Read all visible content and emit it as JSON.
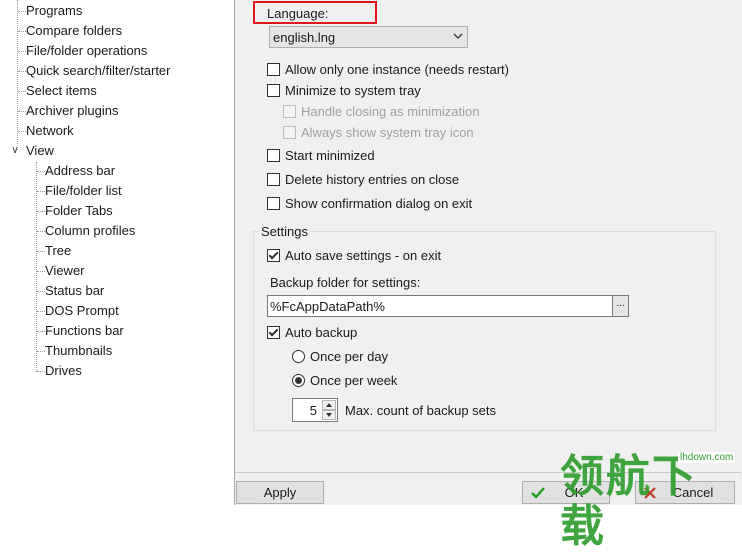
{
  "tree": {
    "items": [
      {
        "label": "Programs",
        "level": 1
      },
      {
        "label": "Compare folders",
        "level": 1
      },
      {
        "label": "File/folder operations",
        "level": 1
      },
      {
        "label": "Quick search/filter/starter",
        "level": 1
      },
      {
        "label": "Select items",
        "level": 1
      },
      {
        "label": "Archiver plugins",
        "level": 1
      },
      {
        "label": "Network",
        "level": 1
      },
      {
        "label": "View",
        "level": 1,
        "expanded": true
      },
      {
        "label": "Address bar",
        "level": 2
      },
      {
        "label": "File/folder list",
        "level": 2
      },
      {
        "label": "Folder Tabs",
        "level": 2
      },
      {
        "label": "Column profiles",
        "level": 2
      },
      {
        "label": "Tree",
        "level": 2
      },
      {
        "label": "Viewer",
        "level": 2
      },
      {
        "label": "Status bar",
        "level": 2
      },
      {
        "label": "DOS Prompt",
        "level": 2
      },
      {
        "label": "Functions bar",
        "level": 2
      },
      {
        "label": "Thumbnails",
        "level": 2
      },
      {
        "label": "Drives",
        "level": 2
      }
    ]
  },
  "language": {
    "label": "Language:",
    "selected": "english.lng",
    "highlight_color": "#e0141b"
  },
  "options": {
    "allow_one_instance": {
      "label": "Allow only one instance (needs restart)",
      "checked": false
    },
    "minimize_to_tray": {
      "label": "Minimize to system tray",
      "checked": false
    },
    "handle_closing": {
      "label": "Handle closing as minimization",
      "checked": false,
      "disabled": true
    },
    "always_show_tray_icon": {
      "label": "Always show system tray icon",
      "checked": false,
      "disabled": true
    },
    "start_minimized": {
      "label": "Start minimized",
      "checked": false
    },
    "delete_history": {
      "label": "Delete history entries on close",
      "checked": false
    },
    "confirm_exit": {
      "label": "Show confirmation dialog on exit",
      "checked": false
    }
  },
  "settings": {
    "title": "Settings",
    "auto_save": {
      "label": "Auto save settings - on exit",
      "checked": true
    },
    "backup_folder_label": "Backup folder for settings:",
    "backup_folder_value": "%FcAppDataPath%",
    "browse_label": "...",
    "auto_backup": {
      "label": "Auto backup",
      "checked": true
    },
    "once_per_day": {
      "label": "Once per day",
      "checked": false
    },
    "once_per_week": {
      "label": "Once per week",
      "checked": true
    },
    "max_count_value": "5",
    "max_count_label": "Max. count of backup sets"
  },
  "buttons": {
    "apply": "Apply",
    "ok": "OK",
    "cancel": "Cancel"
  },
  "watermark": {
    "text": "领航下载",
    "site": "lhdown.com",
    "color": "#2f9e2f"
  }
}
